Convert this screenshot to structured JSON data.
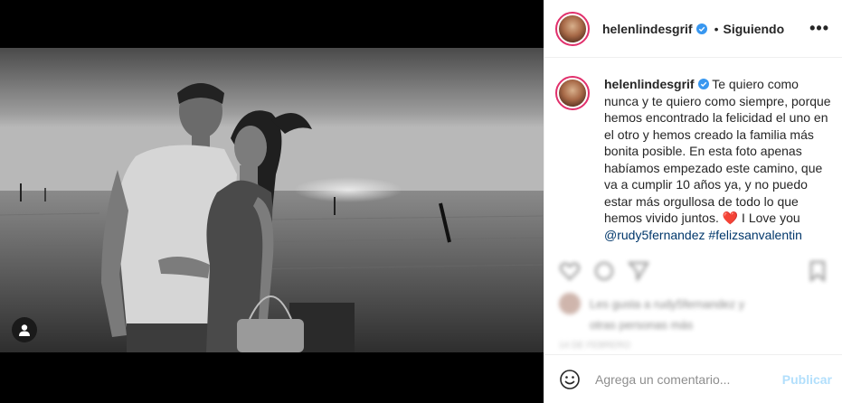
{
  "post": {
    "username": "helenlindesgrif",
    "follow_status": "Siguiendo",
    "separator": "•",
    "more_label": "•••"
  },
  "caption": {
    "username": "helenlindesgrif",
    "text": "Te quiero como nunca y te quiero como siempre, porque hemos encontrado la felicidad el uno en el otro y hemos creado la familia más bonita posible. En esta foto apenas habíamos empezado este camino, que va a cumplir 10 años ya, y no puedo estar más orgullosa de todo lo que hemos vivido juntos. ",
    "emoji": "❤️",
    "text_after": " I Love you ",
    "mention": "@rudy5fernandez",
    "hashtag": "#felizsanvalentin"
  },
  "likes": {
    "text": "Les gusta a rudy5fernandez y",
    "others": "otras personas más",
    "date": "14 DE FEBRERO"
  },
  "comment_box": {
    "placeholder": "Agrega un comentario...",
    "publish_label": "Publicar"
  },
  "colors": {
    "link": "#00376b",
    "publish_disabled": "#b2dffc",
    "verified": "#3897f0"
  },
  "icons": [
    "user-tag-icon",
    "verified-badge-icon",
    "more-options-icon",
    "heart-icon",
    "comment-icon",
    "share-icon",
    "bookmark-icon",
    "emoji-icon"
  ]
}
